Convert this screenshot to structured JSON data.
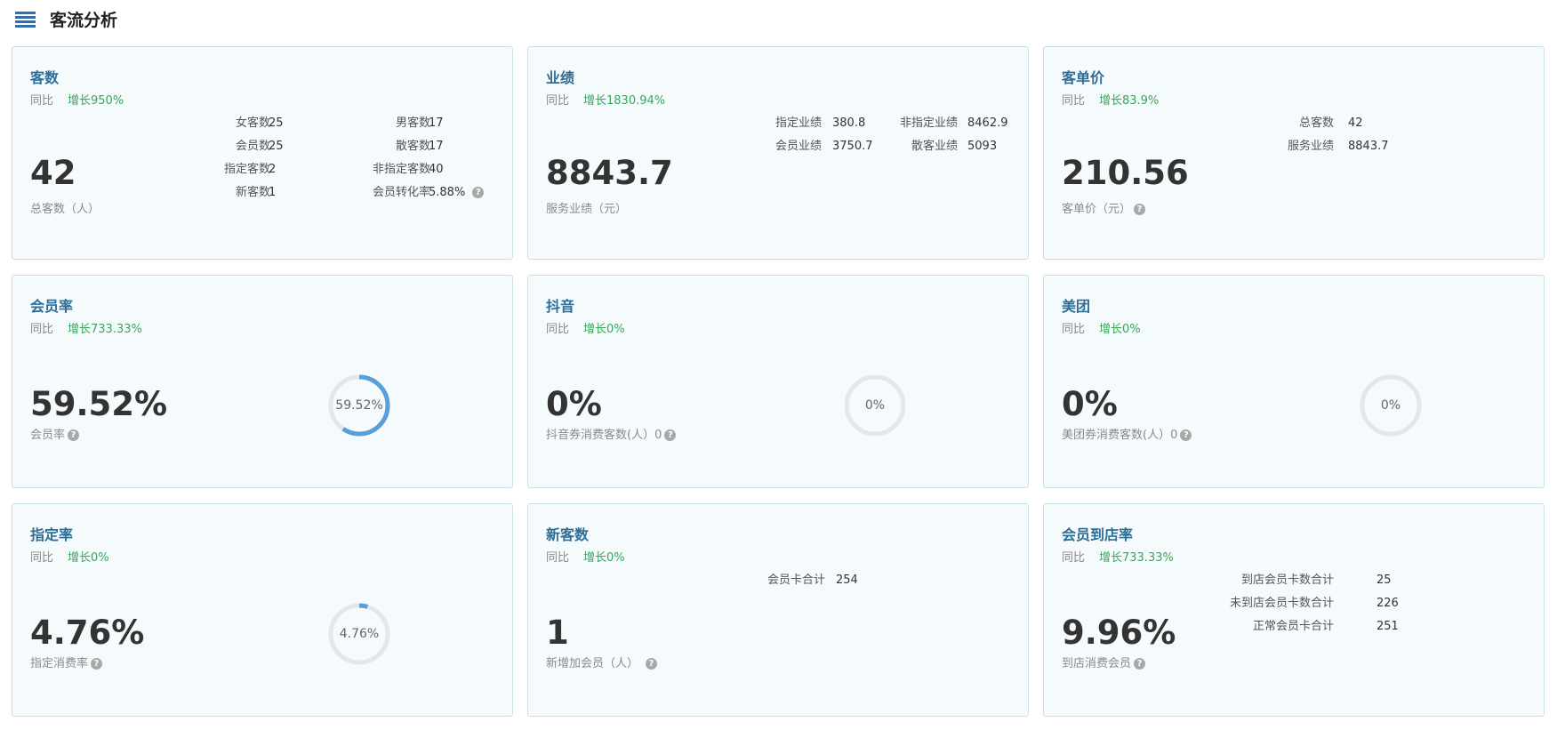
{
  "page": {
    "title": "客流分析"
  },
  "cards": {
    "customers": {
      "title": "客数",
      "yoy_label": "同比",
      "yoy_value": "增长950%",
      "big_value": "42",
      "sub_label": "总客数（人）",
      "stats": [
        {
          "label": "女客数",
          "value": "25"
        },
        {
          "label": "男客数",
          "value": "17"
        },
        {
          "label": "会员数",
          "value": "25"
        },
        {
          "label": "散客数",
          "value": "17"
        },
        {
          "label": "指定客数",
          "value": "2"
        },
        {
          "label": "非指定客数",
          "value": "40"
        },
        {
          "label": "新客数",
          "value": "1"
        },
        {
          "label": "会员转化率",
          "value": "5.88%"
        }
      ]
    },
    "performance": {
      "title": "业绩",
      "yoy_label": "同比",
      "yoy_value": "增长1830.94%",
      "big_value": "8843.7",
      "sub_label": "服务业绩（元）",
      "stats": [
        {
          "label": "指定业绩",
          "value": "380.8"
        },
        {
          "label": "非指定业绩",
          "value": "8462.9"
        },
        {
          "label": "会员业绩",
          "value": "3750.7"
        },
        {
          "label": "散客业绩",
          "value": "5093"
        }
      ]
    },
    "unit_price": {
      "title": "客单价",
      "yoy_label": "同比",
      "yoy_value": "增长83.9%",
      "big_value": "210.56",
      "sub_label": "客单价（元）",
      "stats": [
        {
          "label": "总客数",
          "value": "42"
        },
        {
          "label": "服务业绩",
          "value": "8843.7"
        }
      ]
    },
    "member_rate": {
      "title": "会员率",
      "yoy_label": "同比",
      "yoy_value": "增长733.33%",
      "big_value": "59.52%",
      "sub_label": "会员率",
      "ring_text": "59.52%",
      "ring_fraction": 0.5952
    },
    "douyin": {
      "title": "抖音",
      "yoy_label": "同比",
      "yoy_value": "增长0%",
      "big_value": "0%",
      "sub_label": "抖音券消费客数(人）0",
      "ring_text": "0%",
      "ring_fraction": 0
    },
    "meituan": {
      "title": "美团",
      "yoy_label": "同比",
      "yoy_value": "增长0%",
      "big_value": "0%",
      "sub_label": "美团券消费客数(人）0",
      "ring_text": "0%",
      "ring_fraction": 0
    },
    "designated_rate": {
      "title": "指定率",
      "yoy_label": "同比",
      "yoy_value": "增长0%",
      "big_value": "4.76%",
      "sub_label": "指定消费率",
      "ring_text": "4.76%",
      "ring_fraction": 0.0476
    },
    "new_customers": {
      "title": "新客数",
      "yoy_label": "同比",
      "yoy_value": "增长0%",
      "big_value": "1",
      "sub_label": "新增加会员（人）",
      "stats": [
        {
          "label": "会员卡合计",
          "value": "254"
        }
      ]
    },
    "member_visit_rate": {
      "title": "会员到店率",
      "yoy_label": "同比",
      "yoy_value": "增长733.33%",
      "big_value": "9.96%",
      "sub_label": "到店消费会员",
      "stats": [
        {
          "label": "到店会员卡数合计",
          "value": "25"
        },
        {
          "label": "未到店会员卡数合计",
          "value": "226"
        },
        {
          "label": "正常会员卡合计",
          "value": "251"
        }
      ]
    }
  },
  "colors": {
    "accent": "#2d6e97",
    "growth": "#3aa55a",
    "ring_fill": "#5a9fd9",
    "ring_track": "#e4e7ea"
  }
}
